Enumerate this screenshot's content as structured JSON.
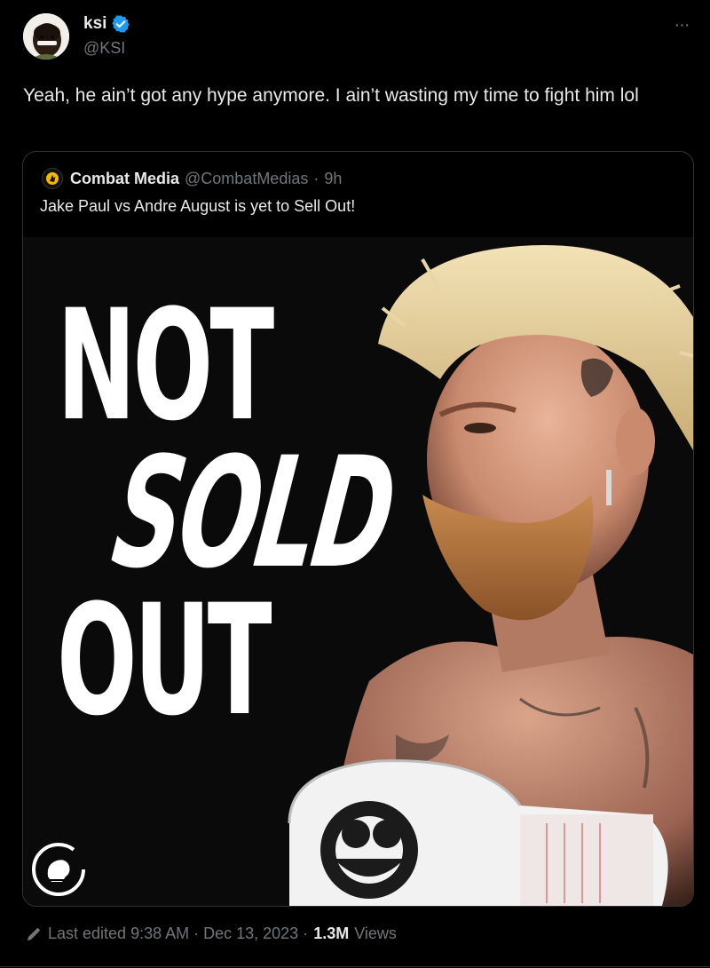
{
  "author": {
    "name": "ksi",
    "handle": "@KSI",
    "verified_color": "#1d9bf0"
  },
  "more_menu": {
    "icon": "ellipsis-icon",
    "label": "···"
  },
  "tweet": {
    "text": "Yeah, he ain’t got any hype anymore. I ain’t wasting my time to fight him lol"
  },
  "quote": {
    "author_name": "Combat Media",
    "author_handle": "@CombatMedias",
    "separator": "·",
    "time": "9h",
    "text": "Jake Paul vs Andre August is yet to Sell Out!",
    "media": {
      "headline_lines": [
        "NOT",
        "SOLD",
        "OUT"
      ],
      "logo_icon": "boxing-glove-logo-icon"
    }
  },
  "footer": {
    "edited_icon": "pencil-icon",
    "edited_text": "Last edited 9:38 AM · Dec 13, 2023 ·",
    "view_count": "1.3M",
    "views_label": "Views"
  },
  "colors": {
    "background": "#000000",
    "text_primary": "#e7e9ea",
    "text_secondary": "#71767b",
    "border": "#2f3336",
    "accent_blue": "#1d9bf0",
    "combat_media_badge": "#f5b800"
  }
}
